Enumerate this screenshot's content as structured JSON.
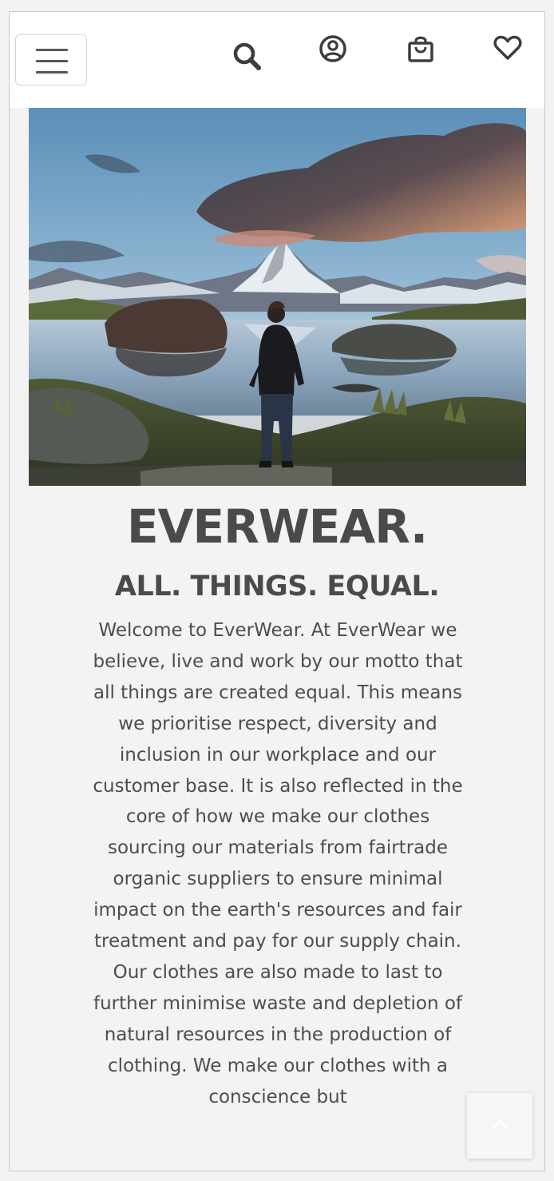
{
  "navbar": {
    "menu_toggle": "menu-toggle",
    "icons": [
      "search-icon",
      "account-icon",
      "shopping-bag-icon",
      "wishlist-heart-icon"
    ]
  },
  "hero": {
    "image": "man-standing-by-mountain-lake"
  },
  "main": {
    "brand": "EVERWEAR.",
    "tagline": "ALL. THINGS. EQUAL.",
    "intro": "Welcome to EverWear. At EverWear we believe, live and work by our motto that all things are created equal. This means we prioritise respect, diversity and inclusion in our workplace and our customer base. It is also reflected in the core of how we make our clothes sourcing our materials from fairtrade organic suppliers to ensure minimal impact on the earth's resources and fair treatment and pay for our supply chain. Our clothes are also made to last to further minimise waste and depletion of natural resources in the production of clothing. We make our clothes with a conscience but"
  },
  "back_to_top": {
    "icon": "chevron-up-icon"
  },
  "colors": {
    "nav_bg": "#ffffff",
    "page_bg": "#f3f3f3",
    "text": "#4a4a4a",
    "icon": "#444444"
  }
}
